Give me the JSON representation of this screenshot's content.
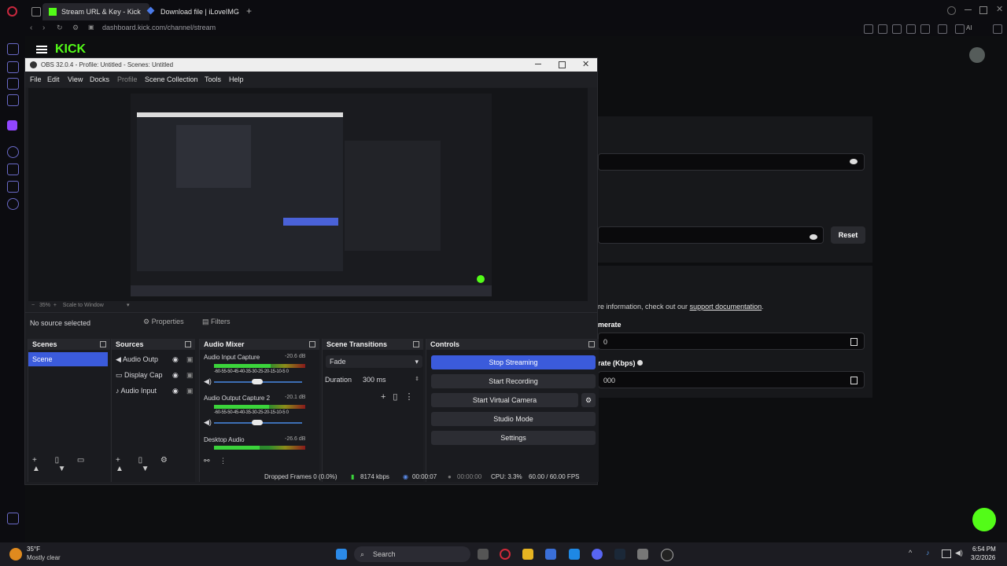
{
  "browser": {
    "tabs": [
      {
        "label": "Stream URL & Key - Kick"
      },
      {
        "label": "Download file | iLoveIMG"
      }
    ],
    "url": "dashboard.kick.com/channel/stream"
  },
  "kick": {
    "logo": "KICK",
    "reset_label": "Reset",
    "info_prefix": "re information, check out our ",
    "info_link": "support documentation",
    "info_suffix": ".",
    "framerate_label": "merate",
    "framerate_value": "0",
    "bitrate_label": "rate (Kbps)",
    "bitrate_value": "000"
  },
  "obs": {
    "title": "OBS 32.0.4 - Profile: Untitled - Scenes: Untitled",
    "menu": [
      "File",
      "Edit",
      "View",
      "Docks",
      "Profile",
      "Scene Collection",
      "Tools",
      "Help"
    ],
    "zoom": "35%",
    "scale_mode": "Scale to Window",
    "no_source": "No source selected",
    "properties_label": "Properties",
    "filters_label": "Filters",
    "scenes": {
      "title": "Scenes",
      "items": [
        "Scene"
      ]
    },
    "sources": {
      "title": "Sources",
      "items": [
        "Audio Outp",
        "Display Cap",
        "Audio Input"
      ]
    },
    "mixer": {
      "title": "Audio Mixer",
      "ticks": "-60-55-50-45-40-35-30-25-20-15-10-5 0",
      "channels": [
        {
          "name": "Audio Input Capture",
          "db": "-20.6 dB",
          "level": 0.62,
          "volume": 0.5
        },
        {
          "name": "Audio Output Capture 2",
          "db": "-20.1 dB",
          "level": 0.6,
          "volume": 0.5
        },
        {
          "name": "Desktop Audio",
          "db": "-26.6 dB",
          "level": 0.5,
          "volume": 0.5
        }
      ]
    },
    "transitions": {
      "title": "Scene Transitions",
      "type": "Fade",
      "duration_label": "Duration",
      "duration_value": "300 ms"
    },
    "controls": {
      "title": "Controls",
      "stop_streaming": "Stop Streaming",
      "start_recording": "Start Recording",
      "start_virtual_camera": "Start Virtual Camera",
      "studio_mode": "Studio Mode",
      "settings": "Settings"
    },
    "status": {
      "dropped": "Dropped Frames 0 (0.0%)",
      "bitrate": "8174 kbps",
      "stream_time": "00:00:07",
      "rec_time": "00:00:00",
      "cpu": "CPU: 3.3%",
      "fps": "60.00 / 60.00 FPS"
    }
  },
  "taskbar": {
    "weather_temp": "35°F",
    "weather_desc": "Mostly clear",
    "search_label": "Search",
    "time": "6:54 PM",
    "date": "3/2/2026"
  },
  "colors": {
    "kick_green": "#53fc18",
    "obs_accent": "#3b5bdb"
  }
}
